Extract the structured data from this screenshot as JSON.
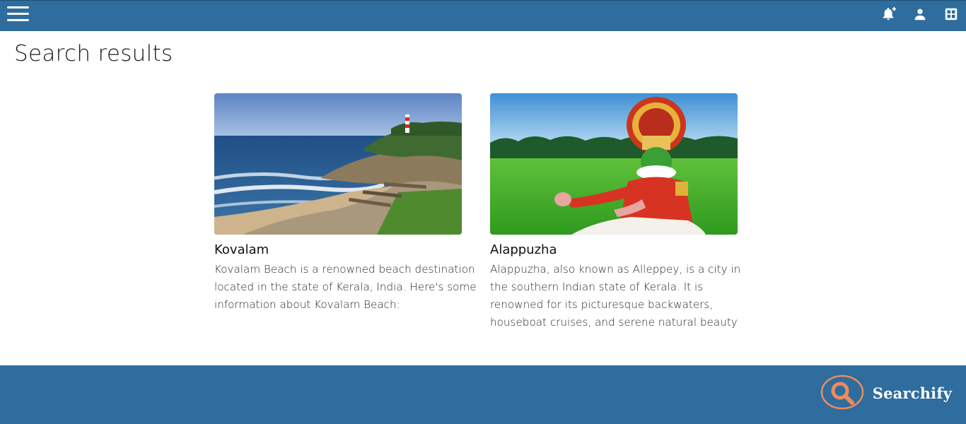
{
  "header": {
    "menu_icon": "hamburger-menu-icon",
    "icons": [
      "bell-plus-icon",
      "user-icon",
      "dashboard-grid-icon"
    ]
  },
  "page": {
    "title": "Search results"
  },
  "results": [
    {
      "title": "Kovalam",
      "description": "Kovalam Beach is a renowned beach destination located in the state of Kerala, India. Here's some information about Kovalam Beach:",
      "image": "beach-lighthouse-photo"
    },
    {
      "title": "Alappuzha",
      "description": "Alappuzha, also known as Alleppey, is a city in the southern Indian state of Kerala. It is renowned for its picturesque backwaters, houseboat cruises, and serene natural beauty",
      "image": "kathakali-dancer-photo"
    }
  ],
  "footer": {
    "brand": "Searchify",
    "logo_icon": "magnifier-logo-icon"
  },
  "colors": {
    "primary": "#2e6d9e",
    "logo_accent": "#f08a5d",
    "text": "#1a1a1a"
  }
}
